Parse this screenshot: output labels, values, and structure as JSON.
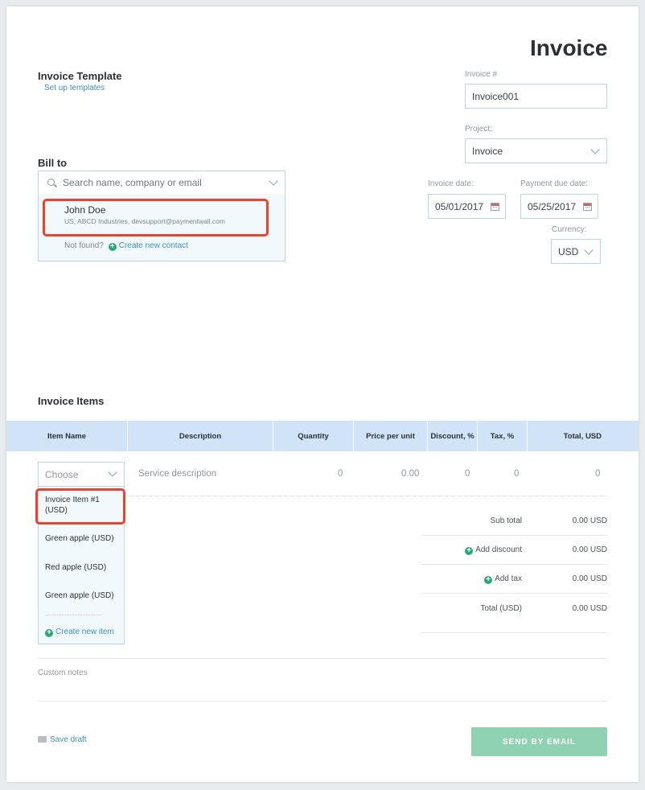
{
  "header": {
    "title": "Invoice"
  },
  "template": {
    "heading": "Invoice Template",
    "setup_link": "Set up templates"
  },
  "invoice_number": {
    "label": "Invoice #",
    "value": "Invoice001"
  },
  "project": {
    "label": "Project:",
    "value": "Invoice"
  },
  "bill_to": {
    "heading": "Bill to",
    "search_placeholder": "Search name, company or email",
    "contact": {
      "name": "John Doe",
      "details": "US, ABCD Industries, devsupport@paymentwall.com"
    },
    "not_found": "Not found?",
    "create_contact": "Create new contact"
  },
  "dates": {
    "invoice_label": "Invoice date:",
    "invoice_value": "05/01/2017",
    "due_label": "Payment due date:",
    "due_value": "05/25/2017"
  },
  "currency": {
    "label": "Currency:",
    "value": "USD"
  },
  "items": {
    "heading": "Invoice Items",
    "columns": [
      "Item Name",
      "Description",
      "Quantity",
      "Price per unit",
      "Discount, %",
      "Tax, %",
      "Total, USD"
    ],
    "row": {
      "item_placeholder": "Choose",
      "description_placeholder": "Service description",
      "quantity": "0",
      "price": "0.00",
      "discount": "0",
      "tax": "0",
      "total": "0"
    },
    "dropdown": [
      "Invoice Item #1 (USD)",
      "Green apple (USD)",
      "Red apple (USD)",
      "Green apple (USD)"
    ],
    "create_item": "Create new item"
  },
  "summary": {
    "subtotal_label": "Sub total",
    "subtotal_value": "0.00 USD",
    "discount_label": "Add discount",
    "discount_value": "0.00 USD",
    "tax_label": "Add tax",
    "tax_value": "0.00 USD",
    "total_label": "Total (USD)",
    "total_value": "0.00 USD"
  },
  "notes": {
    "placeholder": "Custom notes"
  },
  "footer": {
    "save_draft": "Save draft",
    "send_button": "SEND BY EMAIL"
  },
  "colors": {
    "accent": "#3f8fc4",
    "table_header": "#d1e4f7",
    "send_button": "#8ed2b2",
    "highlight": "#e8452c",
    "plus": "#2aa876"
  }
}
